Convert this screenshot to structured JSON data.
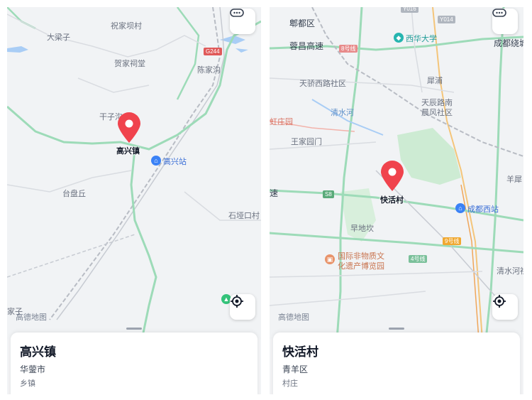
{
  "left": {
    "place_labels": [
      "大梁子",
      "祝家坝村",
      "贺家祠堂",
      "陈家沟",
      "干子沟",
      "台盘丘",
      "石垭口村",
      "家子"
    ],
    "road_badge": "G244",
    "poi_station": "高兴站",
    "pin_label": "高兴镇",
    "logo": "高德地图",
    "card": {
      "title": "高兴镇",
      "region": "华蓥市",
      "type": "乡镇"
    }
  },
  "right": {
    "place_labels": [
      "郫都区",
      "蓉昌高速",
      "天骄西路社区",
      "犀浦",
      "天辰路南",
      "晨风社区",
      "清水河",
      "虹庄园",
      "王家园门",
      "速",
      "早地坎",
      "羊犀",
      "清水河社",
      "成都绕城"
    ],
    "road_badges": [
      "8号线",
      "S8",
      "9号线",
      "4号线",
      "Y016",
      "Y014"
    ],
    "poi_university": "西华大学",
    "poi_station": "成都西站",
    "poi_museum": "国际非物质文化遗产博览园",
    "poi_museum_line1": "国际非物质文",
    "poi_museum_line2": "化遗产博览园",
    "pin_label": "快活村",
    "logo": "高德地图",
    "card": {
      "title": "快活村",
      "region": "青羊区",
      "type": "村庄"
    }
  },
  "colors": {
    "pin": "#f0434d",
    "main_road": "#9ddbb8",
    "rail": "#b8bcc4",
    "water": "#a9cdf5",
    "poi_blue": "#3b82f6",
    "park": "#cdebd3"
  },
  "icons": {
    "menu": "more-dots-icon",
    "locate": "locate-crosshair-icon",
    "pin": "map-pin-icon"
  }
}
